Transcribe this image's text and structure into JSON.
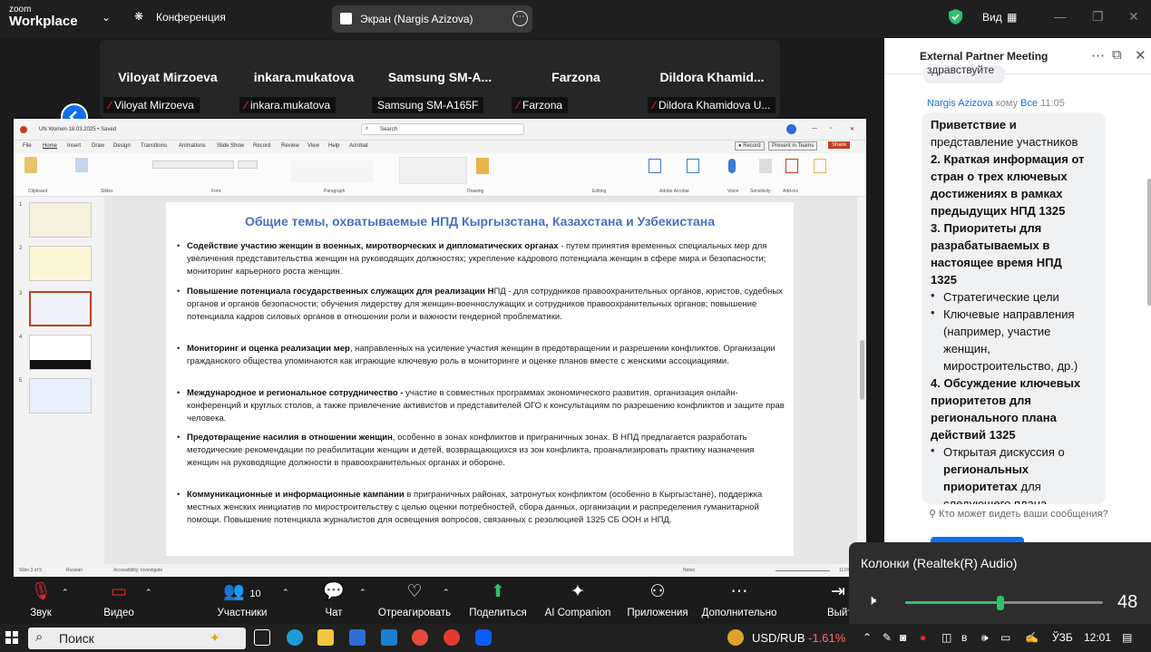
{
  "topbar": {
    "logo_small": "zoom",
    "logo_big": "Workplace",
    "conference_label": "Конференция",
    "screen_label": "Экран (Nargis Azizova)",
    "view_label": "Вид"
  },
  "participants": [
    {
      "name": "Viloyat Mirzoeva",
      "sub": "Viloyat Mirzoeva"
    },
    {
      "name": "inkara.mukatova",
      "sub": "inkara.mukatova"
    },
    {
      "name": "Samsung  SM-A...",
      "sub": "Samsung SM-A165F"
    },
    {
      "name": "Farzona",
      "sub": "Farzona"
    },
    {
      "name": "Dildora  Khamid...",
      "sub": "Dildora Khamidova U..."
    }
  ],
  "ppt": {
    "filename": "UN Women  18.03.2025 • Saved",
    "search": "Search",
    "tabs": [
      "File",
      "Home",
      "Insert",
      "Draw",
      "Design",
      "Transitions",
      "Animations",
      "Slide Show",
      "Record",
      "Review",
      "View",
      "Help",
      "Acrobat"
    ],
    "record_btn": "Record",
    "present_btn": "Present in Teams",
    "share_btn": "Share",
    "groups": [
      "Clipboard",
      "Slides",
      "Font",
      "Paragraph",
      "Drawing",
      "Editing",
      "Adobe Acrobat",
      "Voice",
      "Sensitivity",
      "Add-ins"
    ],
    "status_left": "Slide 3 of 5",
    "status_lang": "Russian",
    "status_access": "Accessibility: Investigate",
    "status_notes": "Notes",
    "status_zoom": "111%",
    "slide": {
      "title": "Общие темы, охватываемые НПД Кыргызстана, Казахстана и Узбекистана",
      "bullets": [
        {
          "bold": "Содействие участию женщин в военных, миротворческих и дипломатических органах",
          "rest": " - путем принятия временных специальных мер для увеличения представительства женщин на руководящих должностях; укрепление кадрового потенциала женщин в сфере мира и безопасности; мониторинг карьерного роста женщин."
        },
        {
          "bold": "Повышение потенциала государственных служащих для реализации Н",
          "rest": "ПД - для сотрудников правоохранительных органов, юристов, судебных органов и органов безопасности; обучения лидерству для женщин-военнослужащих и сотрудников правоохранительных органов; повышение потенциала кадров силовых органов в отношении роли и важности гендерной проблематики."
        },
        {
          "bold": "Мониторинг и оценка реализации мер",
          "rest": ", направленных на усиление участия женщин в предотвращении и разрешении конфликтов. Организации гражданского общества упоминаются как играющие ключевую роль в мониторинге и оценке планов вместе с женскими ассоциациями."
        },
        {
          "bold": "Международное и региональное сотрудничество -",
          "rest": " участие в совместных программах экономического развития, организация онлайн-конференций и круглых столов, а также привлечение активистов и представителей ОГО  к консультациям по разрешению конфликтов и защите прав человека."
        },
        {
          "bold": "Предотвращение насилия в отношении женщин",
          "rest": ", особенно в зонах конфликтов и приграничных зонах. В НПД предлагается разработать методические рекомендации по реабилитации женщин и детей, возвращающихся из зон конфликта, проанализировать практику назначения женщин на руководящие должности в правоохранительных органах и обороне."
        },
        {
          "bold": "Коммуникационные и информационные кампании",
          "rest": " в приграничных районах, затронутых конфликтом (особенно в Кыргызстане), поддержка местных женских инициатив по миростроительству с целью оценки потребностей, сбора данных, организации и распределения гуманитарной помощи. Повышение потенциала журналистов для освещения вопросов, связанных с резолюцией 1325 СБ ООН и НПД."
        }
      ]
    }
  },
  "chat": {
    "title": "External Partner Meeting",
    "prev_text": "здравствуйте",
    "sender": "Nargis Azizova",
    "to": "кому",
    "recipient": "Все",
    "time": "11:05",
    "lines": [
      {
        "text": "Приветствие и",
        "bold": true,
        "kind": "plain"
      },
      {
        "text": "представление участников",
        "bold": false,
        "kind": "plain"
      },
      {
        "text": "2. Краткая информация от",
        "bold": true,
        "kind": "plain"
      },
      {
        "text": "стран о трех ключевых",
        "bold": true,
        "kind": "plain"
      },
      {
        "text": "достижениях в рамках",
        "bold": true,
        "kind": "plain"
      },
      {
        "text": "предыдущих НПД 1325",
        "bold": true,
        "kind": "plain"
      },
      {
        "text": "3. Приоритеты для",
        "bold": true,
        "kind": "plain"
      },
      {
        "text": "разрабатываемых в",
        "bold": true,
        "kind": "plain"
      },
      {
        "text": "настоящее время НПД",
        "bold": true,
        "kind": "plain"
      },
      {
        "text": "1325",
        "bold": true,
        "kind": "plain"
      },
      {
        "text": "Стратегические цели",
        "bold": false,
        "kind": "bullet"
      },
      {
        "text": "Ключевые направления",
        "bold": false,
        "kind": "bullet"
      },
      {
        "text": "(например, участие",
        "bold": false,
        "kind": "indent"
      },
      {
        "text": "женщин,",
        "bold": false,
        "kind": "indent"
      },
      {
        "text": "миростроительство, др.)",
        "bold": false,
        "kind": "indent"
      },
      {
        "text": "4. Обсуждение ключевых",
        "bold": true,
        "kind": "plain"
      },
      {
        "text": "приоритетов для",
        "bold": true,
        "kind": "plain"
      },
      {
        "text": "регионального плана",
        "bold": true,
        "kind": "plain"
      },
      {
        "text": "действий 1325",
        "bold": true,
        "kind": "plain"
      },
      {
        "text": "Открытая дискуссия о",
        "bold": false,
        "kind": "bullet"
      },
      {
        "text": "региональных",
        "bold": true,
        "kind": "indent"
      },
      {
        "text": "приоритетах",
        "bold": true,
        "kind": "indent",
        "suffix": " для"
      },
      {
        "text": "следующего плана",
        "bold": false,
        "kind": "indent"
      }
    ],
    "who_can_see": "Кто может видеть ваши сообщения?"
  },
  "audio": {
    "device": "Колонки (Realtek(R) Audio)",
    "volume": 48,
    "volume_text": "48"
  },
  "toolbar": [
    {
      "icon": "mic-muted-icon",
      "label": "Звук",
      "glyph": "🎙"
    },
    {
      "icon": "video-off-icon",
      "label": "Видео",
      "glyph": "▭"
    },
    {
      "icon": "participants-icon",
      "label": "Участники",
      "glyph": "👥",
      "count": "10"
    },
    {
      "icon": "chat-icon",
      "label": "Чат",
      "glyph": "💬"
    },
    {
      "icon": "react-icon",
      "label": "Отреагировать",
      "glyph": "♡"
    },
    {
      "icon": "share-icon",
      "label": "Поделиться",
      "glyph": "⬆"
    },
    {
      "icon": "ai-companion-icon",
      "label": "AI Companion",
      "glyph": "✦"
    },
    {
      "icon": "apps-icon",
      "label": "Приложения",
      "glyph": "⚇"
    },
    {
      "icon": "more-icon",
      "label": "Дополнительно",
      "glyph": "⋯"
    },
    {
      "icon": "leave-icon",
      "label": "Выйт",
      "glyph": "⇥"
    }
  ],
  "taskbar": {
    "search": "Поиск",
    "usd_label": "USD/RUB",
    "usd_change": "-1.61%",
    "lang": "ЎЗБ",
    "time": "12:01"
  },
  "colors": {
    "accent": "#0e71eb",
    "green": "#2dc26b",
    "ppt_orange": "#c43e1c"
  }
}
